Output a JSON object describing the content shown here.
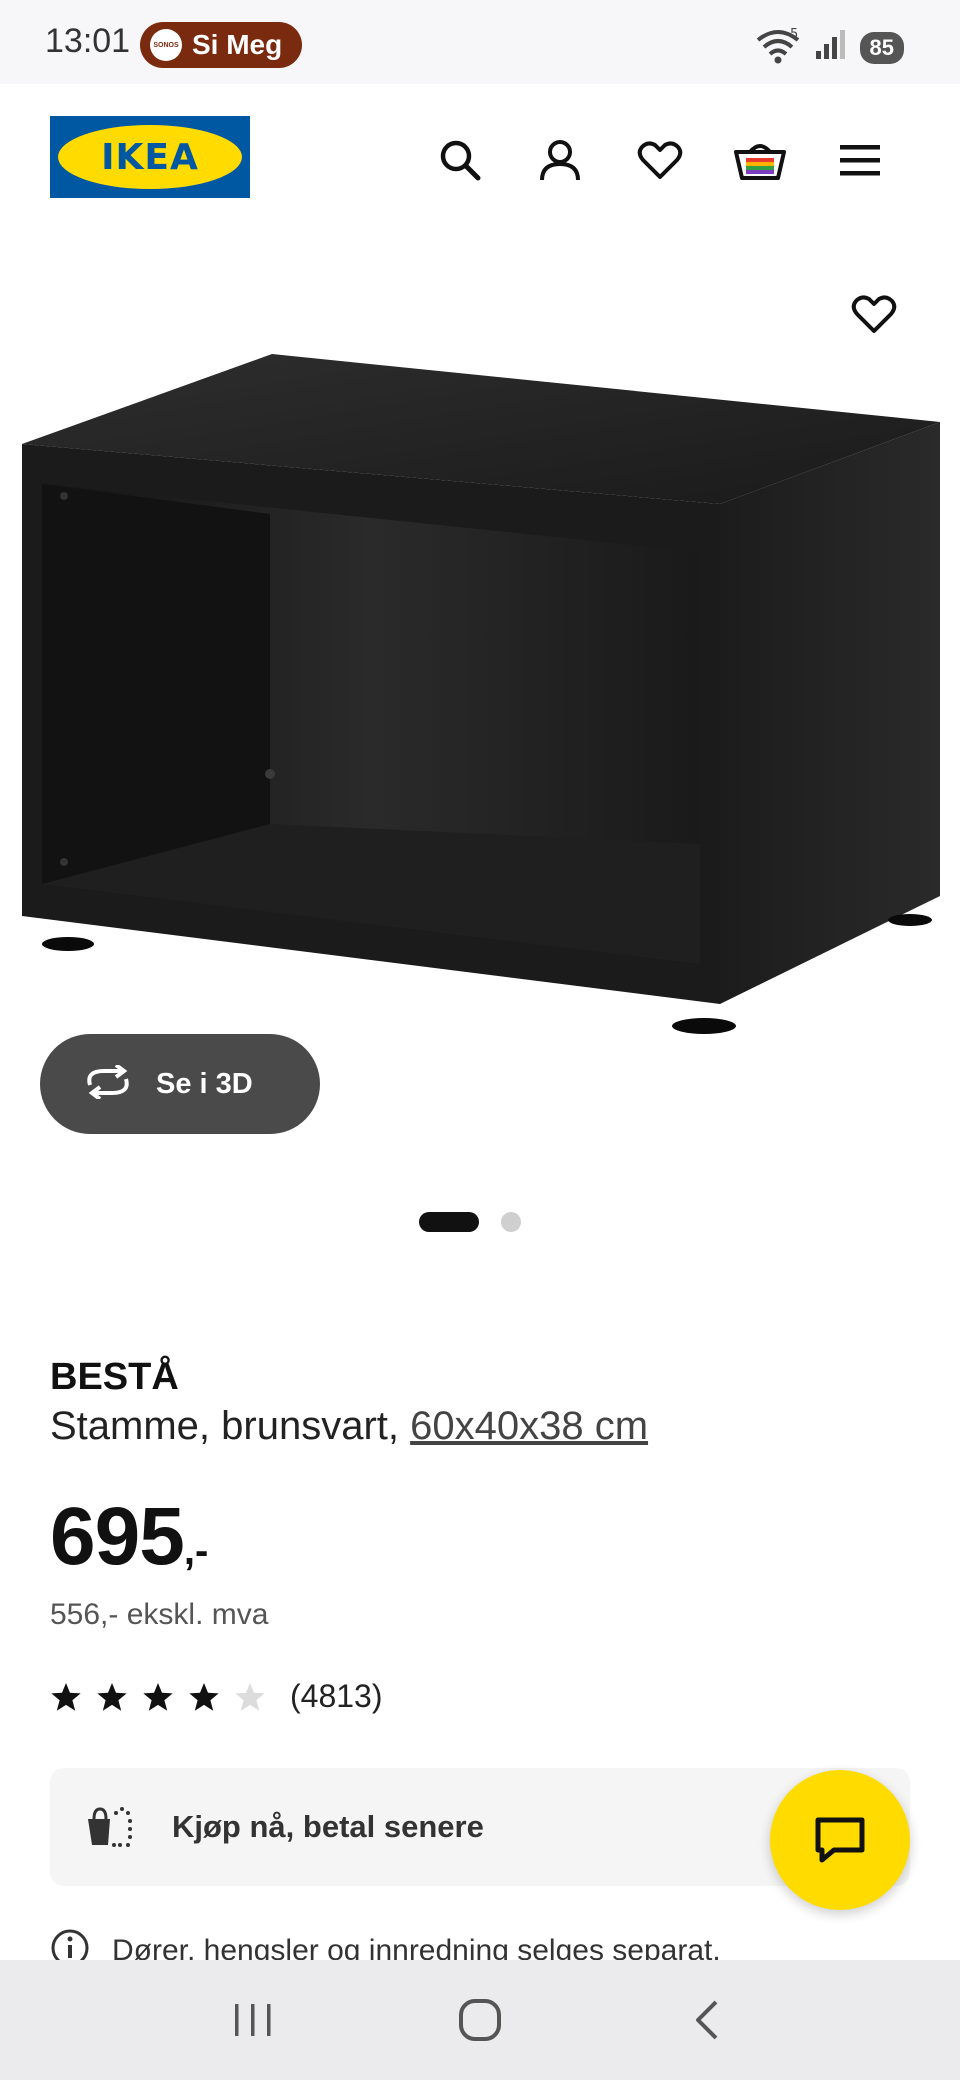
{
  "status_bar": {
    "time": "13:01",
    "media_pill": {
      "logo_text": "SONOS",
      "label": "Si Meg",
      "color": "#7a2a0e"
    },
    "wifi_label": "5",
    "battery": "85",
    "icons": [
      "wifi-icon",
      "signal-icon",
      "battery-icon"
    ]
  },
  "header": {
    "logo_text": "IKEA",
    "icons": [
      "search-icon",
      "account-icon",
      "favorites-icon",
      "cart-icon",
      "menu-icon"
    ],
    "brand_colors": {
      "blue": "#0058a3",
      "yellow": "#ffdb00"
    }
  },
  "product_image": {
    "alt": "BESTÅ",
    "view_3d_label": "Se i 3D",
    "carousel": {
      "active_index": 0,
      "total": 2
    }
  },
  "product": {
    "brand": "BESTÅ",
    "description": "Stamme, brunsvart, ",
    "size_link": "60x40x38 cm",
    "price_main": "695",
    "price_suffix": ",-",
    "price_excl": "556,- ekskl. mva",
    "rating": {
      "value": 4,
      "max": 5,
      "count": "(4813)"
    }
  },
  "klarna": {
    "label": "Kjøp nå, betal senere"
  },
  "note": {
    "text": "Dører, hengsler og innredning selges separat."
  },
  "nav": {
    "icons": [
      "recent-apps-icon",
      "home-icon",
      "back-icon"
    ]
  }
}
